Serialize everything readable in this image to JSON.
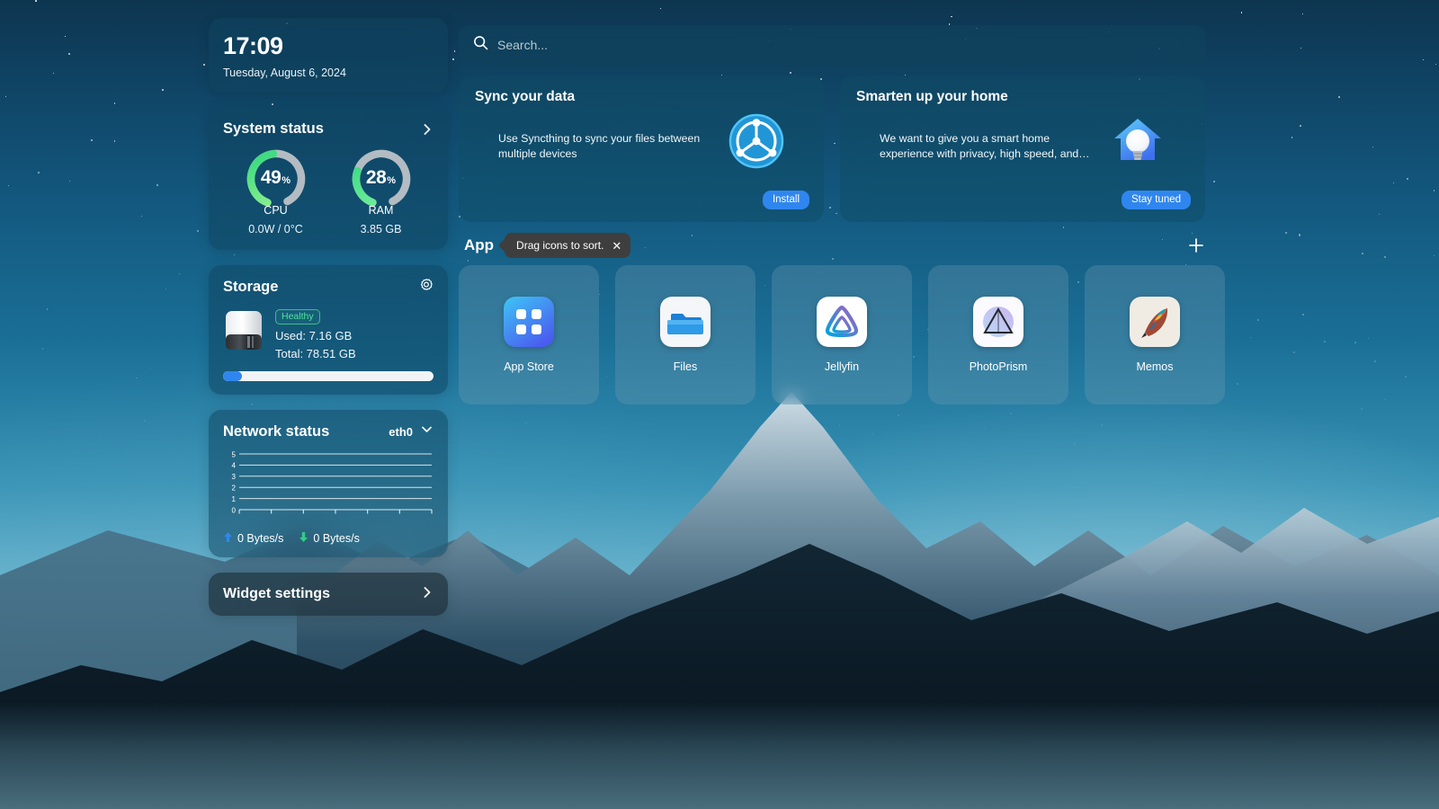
{
  "wallpaper": {
    "description": "night sky over snowy mountain"
  },
  "clock": {
    "time": "17:09",
    "date": "Tuesday, August 6, 2024"
  },
  "system_status": {
    "title": "System status",
    "chevron_icon": "chevron-right-icon",
    "gauges": [
      {
        "value": "49",
        "unit": "%",
        "label": "CPU",
        "sub": "0.0W / 0°C",
        "percent": 49
      },
      {
        "value": "28",
        "unit": "%",
        "label": "RAM",
        "sub": "3.85 GB",
        "percent": 28
      }
    ],
    "accent_color": "#4fe08a",
    "track_color": "#b3bcc2"
  },
  "storage": {
    "title": "Storage",
    "gear_icon": "gear-icon",
    "drive_icon": "hard-drive-icon",
    "badge": "Healthy",
    "used": "Used: 7.16 GB",
    "total": "Total: 78.51 GB",
    "used_percent": 9,
    "bar_color": "#2f86ef",
    "badge_color": "#4ee39a"
  },
  "network": {
    "title": "Network status",
    "interface": "eth0",
    "chevron_icon": "chevron-down-icon",
    "upload_icon": "arrow-up-icon",
    "download_icon": "arrow-down-icon",
    "upload": "0 Bytes/s",
    "download": "0 Bytes/s",
    "upload_color": "#2f86ef",
    "download_color": "#33cc88",
    "chart_data": {
      "type": "line",
      "title": "Network status",
      "series": [
        {
          "name": "upload",
          "values": [
            0,
            0,
            0,
            0,
            0,
            0,
            0
          ]
        },
        {
          "name": "download",
          "values": [
            0,
            0,
            0,
            0,
            0,
            0,
            0
          ]
        }
      ],
      "x": [
        0,
        1,
        2,
        3,
        4,
        5,
        6
      ],
      "ytick_labels": [
        "5",
        "4",
        "3",
        "2",
        "1",
        "0"
      ],
      "ylim": [
        0,
        5
      ],
      "xlabel": "",
      "ylabel": "",
      "grid": true,
      "legend": [
        "0 Bytes/s",
        "0 Bytes/s"
      ]
    }
  },
  "widget_settings": {
    "label": "Widget settings",
    "chevron_icon": "chevron-right-icon"
  },
  "search": {
    "placeholder": "Search...",
    "icon": "search-icon"
  },
  "promos": [
    {
      "title": "Sync your data",
      "desc": "Use Syncthing to sync your files between multiple devices",
      "button": "Install",
      "icon": "syncthing-icon"
    },
    {
      "title": "Smarten up your home",
      "desc": "We want to give you a smart home experience with privacy, high speed, and…",
      "button": "Stay tuned",
      "icon": "smart-home-bulb-icon"
    }
  ],
  "app_section": {
    "title": "App",
    "tooltip": "Drag icons to sort.",
    "tooltip_close_icon": "close-icon",
    "add_icon": "plus-icon",
    "apps": [
      {
        "name": "App Store",
        "icon": "app-store-icon"
      },
      {
        "name": "Files",
        "icon": "files-folder-icon"
      },
      {
        "name": "Jellyfin",
        "icon": "jellyfin-icon"
      },
      {
        "name": "PhotoPrism",
        "icon": "photoprism-icon"
      },
      {
        "name": "Memos",
        "icon": "memos-quill-icon"
      }
    ]
  }
}
